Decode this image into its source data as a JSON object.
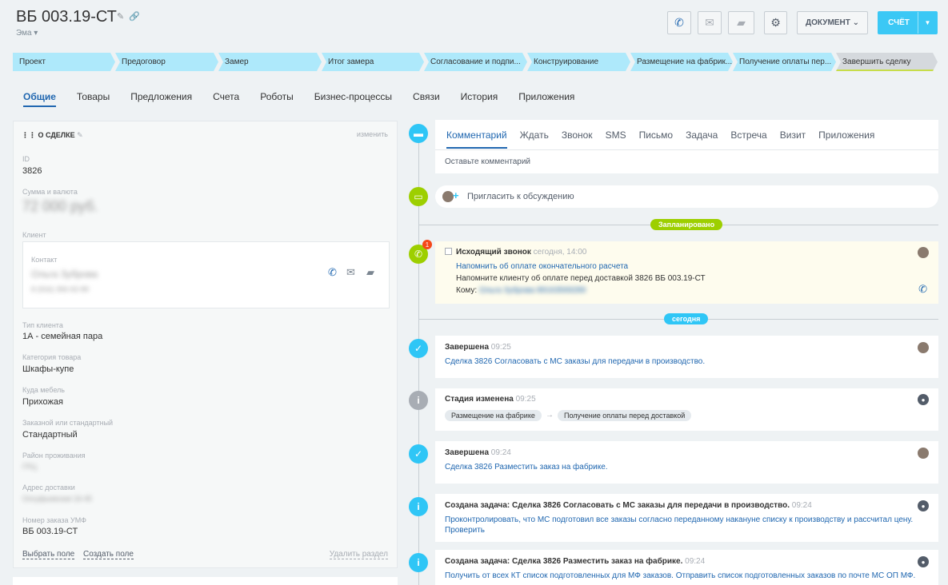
{
  "header": {
    "title": "ВБ 003.19-СТ",
    "subtitle": "Эма",
    "document_label": "ДОКУМЕНТ",
    "invoice_label": "СЧЁТ"
  },
  "stages": [
    "Проект",
    "Предоговор",
    "Замер",
    "Итог замера",
    "Согласование и подпи...",
    "Конструирование",
    "Размещение на фабрик...",
    "Получение оплаты пер...",
    "Завершить сделку"
  ],
  "tabs": [
    "Общие",
    "Товары",
    "Предложения",
    "Счета",
    "Роботы",
    "Бизнес-процессы",
    "Связи",
    "История",
    "Приложения"
  ],
  "deal": {
    "section_title": "О СДЕЛКЕ",
    "edit_label": "изменить",
    "id_label": "ID",
    "id_value": "3826",
    "sum_label": "Сумма и валюта",
    "sum_value": "72 000 руб.",
    "client_label": "Клиент",
    "contact_label": "Контакт",
    "contact_name": "Ольга Зуброва",
    "contact_phone": "8 (916) 356-92-89",
    "client_type_label": "Тип клиента",
    "client_type_value": "1А - семейная пара",
    "category_label": "Категория товара",
    "category_value": "Шкафы-купе",
    "where_label": "Куда мебель",
    "where_value": "Прихожая",
    "order_type_label": "Заказной или стандартный",
    "order_type_value": "Стандартный",
    "district_label": "Район проживания",
    "district_value": "ГРЦ",
    "address_label": "Адрес доставки",
    "address_value": "Олсуфьевская 16-45",
    "order_no_label": "Номер заказа УМФ",
    "order_no_value": "ВБ 003.19-СТ",
    "select_field": "Выбрать поле",
    "create_field": "Создать поле",
    "delete_section": "Удалить раздел"
  },
  "timeline": {
    "compose_tabs": [
      "Комментарий",
      "Ждать",
      "Звонок",
      "SMS",
      "Письмо",
      "Задача",
      "Встреча",
      "Визит",
      "Приложения"
    ],
    "comment_placeholder": "Оставьте комментарий",
    "invite_label": "Пригласить к обсуждению",
    "planned_label": "Запланировано",
    "today_label": "сегодня",
    "call_badge": "1",
    "call_title": "Исходящий звонок",
    "call_time": "сегодня, 14:00",
    "call_link": "Напомнить об оплате окончательного расчета",
    "call_desc": "Напомните клиенту об оплате перед доставкой 3826 ВБ 003.19-СТ",
    "call_to_label": "Кому:",
    "call_to_value": "Ольга Зуброва 89163569289",
    "done1_title": "Завершена",
    "done1_time": "09:25",
    "done1_link": "Сделка 3826 Согласовать с МС заказы для передачи в производство.",
    "stage_title": "Стадия изменена",
    "stage_time": "09:25",
    "stage_from": "Размещение на фабрике",
    "stage_arrow": "→",
    "stage_to": "Получение оплаты перед доставкой",
    "done2_title": "Завершена",
    "done2_time": "09:24",
    "done2_link": "Сделка 3826 Разместить заказ на фабрике.",
    "task1_title": "Создана задача: Сделка 3826 Согласовать с МС заказы для передачи в производство.",
    "task1_time": "09:24",
    "task1_link1": "Проконтролировать, что МС подготовил все заказы согласно переданному накануне списку к производству и рассчитал цену.",
    "task1_link2": "Проверить",
    "task2_title": "Создана задача: Сделка 3826 Разместить заказ на фабрике.",
    "task2_time": "09:24",
    "task2_link1": "Получить от всех КТ список подготовленных для МФ заказов. Отправить список подготовленных заказов по почте МС ОП МФ."
  },
  "colors": {
    "accent": "#2067b0",
    "stage": "#aee9fb",
    "button": "#3bc8f5",
    "green": "#9dcf00",
    "info": "#2fc6f6",
    "gray": "#a8adb4"
  }
}
